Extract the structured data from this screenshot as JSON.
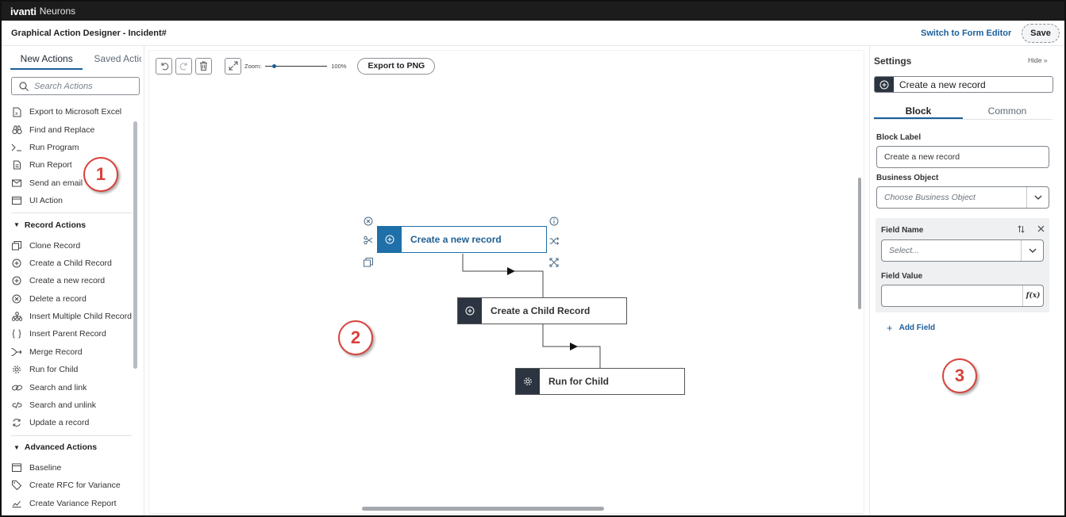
{
  "brand": {
    "name_bold": "ivanti",
    "name_light": "Neurons"
  },
  "header": {
    "title": "Graphical Action Designer - Incident#",
    "switch_link": "Switch to Form Editor",
    "save_label": "Save"
  },
  "left_panel": {
    "tabs": [
      {
        "label": "New Actions",
        "active": true
      },
      {
        "label": "Saved Actic",
        "active": false
      }
    ],
    "search_placeholder": "Search Actions",
    "items_general": [
      {
        "label": "Export to Microsoft Excel",
        "icon": "excel-icon"
      },
      {
        "label": "Find and Replace",
        "icon": "binoculars-icon"
      },
      {
        "label": "Run Program",
        "icon": "terminal-icon"
      },
      {
        "label": "Run Report",
        "icon": "report-icon"
      },
      {
        "label": "Send an email",
        "icon": "email-icon"
      },
      {
        "label": "UI Action",
        "icon": "window-icon"
      }
    ],
    "section_record": "Record Actions",
    "items_record": [
      {
        "label": "Clone Record",
        "icon": "clone-icon"
      },
      {
        "label": "Create a Child Record",
        "icon": "plus-circle-icon"
      },
      {
        "label": "Create a new record",
        "icon": "plus-circle-icon"
      },
      {
        "label": "Delete a record",
        "icon": "x-circle-icon"
      },
      {
        "label": "Insert Multiple Child Record",
        "icon": "hierarchy-icon"
      },
      {
        "label": "Insert Parent Record",
        "icon": "braces-icon"
      },
      {
        "label": "Merge Record",
        "icon": "merge-icon"
      },
      {
        "label": "Run for Child",
        "icon": "gear-icon"
      },
      {
        "label": "Search and link",
        "icon": "link-icon"
      },
      {
        "label": "Search and unlink",
        "icon": "unlink-icon"
      },
      {
        "label": "Update a record",
        "icon": "refresh-icon"
      }
    ],
    "section_advanced": "Advanced Actions",
    "items_advanced": [
      {
        "label": "Baseline",
        "icon": "calendar-icon"
      },
      {
        "label": "Create RFC for Variance",
        "icon": "tag-icon"
      },
      {
        "label": "Create Variance Report",
        "icon": "chart-icon"
      }
    ]
  },
  "canvas": {
    "zoom_label": "Zoom:",
    "zoom_value": "100%",
    "zoom_fraction": 0.15,
    "export_label": "Export to PNG",
    "nodes": [
      {
        "label": "Create a new record",
        "icon": "plus-circle-icon",
        "selected": true
      },
      {
        "label": "Create a Child Record",
        "icon": "plus-circle-icon",
        "selected": false
      },
      {
        "label": "Run for Child",
        "icon": "gear-icon",
        "selected": false
      }
    ]
  },
  "callouts": [
    "1",
    "2",
    "3"
  ],
  "settings": {
    "title": "Settings",
    "hide_label": "Hide",
    "record_label": "Create a new record",
    "tabs": [
      {
        "label": "Block",
        "active": true
      },
      {
        "label": "Common",
        "active": false
      }
    ],
    "block_label_title": "Block Label",
    "block_label_value": "Create a new record",
    "business_object_title": "Business Object",
    "business_object_placeholder": "Choose Business Object",
    "field_name_title": "Field Name",
    "field_name_placeholder": "Select...",
    "field_value_title": "Field Value",
    "fx_label": "f(x)",
    "add_field_label": "Add Field"
  },
  "colors": {
    "accent": "#1b5e9b",
    "node_selected": "#1f6fa8",
    "node_icon_bg": "#2b3440",
    "callout": "#d9413b"
  }
}
